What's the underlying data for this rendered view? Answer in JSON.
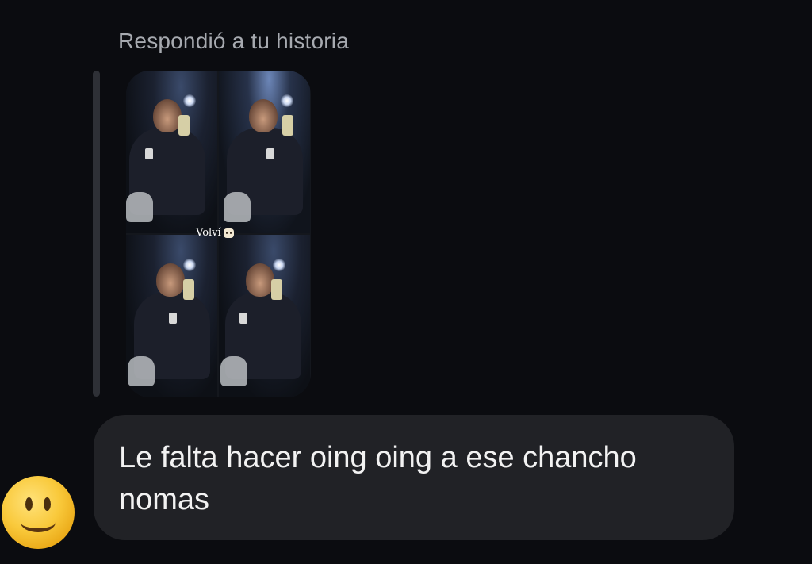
{
  "reply_context": {
    "label": "Respondió a tu historia"
  },
  "story": {
    "caption": "Volví",
    "caption_emoji": "smiling-face-emoji-small",
    "tiles": 4
  },
  "message": {
    "text": "Le falta hacer oing oing a ese chancho nomas",
    "sender_avatar": "smiley-face-emoji"
  },
  "colors": {
    "background": "#0b0c10",
    "bubble": "#212226",
    "label": "#a7aab0",
    "reply_bar": "#2e3036",
    "text": "#f2f2f2"
  }
}
